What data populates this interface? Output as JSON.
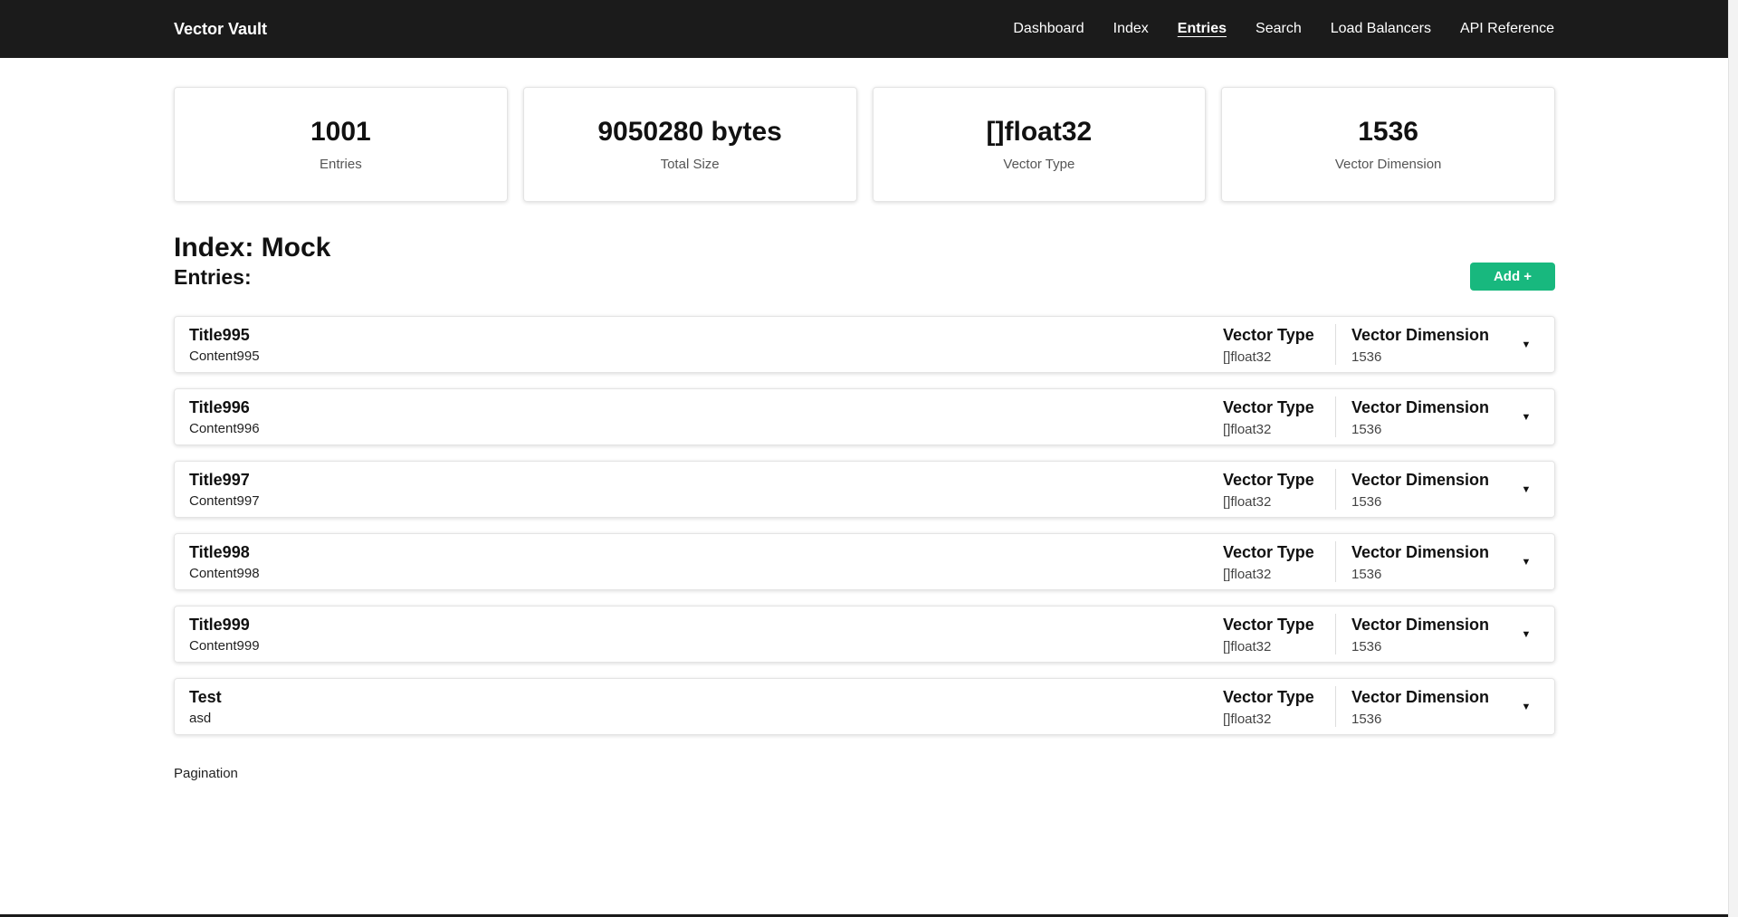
{
  "header": {
    "brand": "Vector Vault",
    "nav": [
      {
        "label": "Dashboard",
        "active": false
      },
      {
        "label": "Index",
        "active": false
      },
      {
        "label": "Entries",
        "active": true
      },
      {
        "label": "Search",
        "active": false
      },
      {
        "label": "Load Balancers",
        "active": false
      },
      {
        "label": "API Reference",
        "active": false
      }
    ]
  },
  "stats": [
    {
      "value": "1001",
      "label": "Entries"
    },
    {
      "value": "9050280 bytes",
      "label": "Total Size"
    },
    {
      "value": "[]float32",
      "label": "Vector Type"
    },
    {
      "value": "1536",
      "label": "Vector Dimension"
    }
  ],
  "index": {
    "title": "Index: Mock",
    "entries_heading": "Entries:",
    "add_label": "Add +"
  },
  "entry_labels": {
    "type": "Vector Type",
    "dimension": "Vector Dimension"
  },
  "entries": [
    {
      "title": "Title995",
      "content": "Content995",
      "type": "[]float32",
      "dimension": "1536"
    },
    {
      "title": "Title996",
      "content": "Content996",
      "type": "[]float32",
      "dimension": "1536"
    },
    {
      "title": "Title997",
      "content": "Content997",
      "type": "[]float32",
      "dimension": "1536"
    },
    {
      "title": "Title998",
      "content": "Content998",
      "type": "[]float32",
      "dimension": "1536"
    },
    {
      "title": "Title999",
      "content": "Content999",
      "type": "[]float32",
      "dimension": "1536"
    },
    {
      "title": "Test",
      "content": "asd",
      "type": "[]float32",
      "dimension": "1536"
    }
  ],
  "pagination": "Pagination",
  "colors": {
    "nav_bg": "#1b1b1b",
    "accent": "#18b87e"
  },
  "icons": {
    "expand": "chevron-down-icon"
  }
}
